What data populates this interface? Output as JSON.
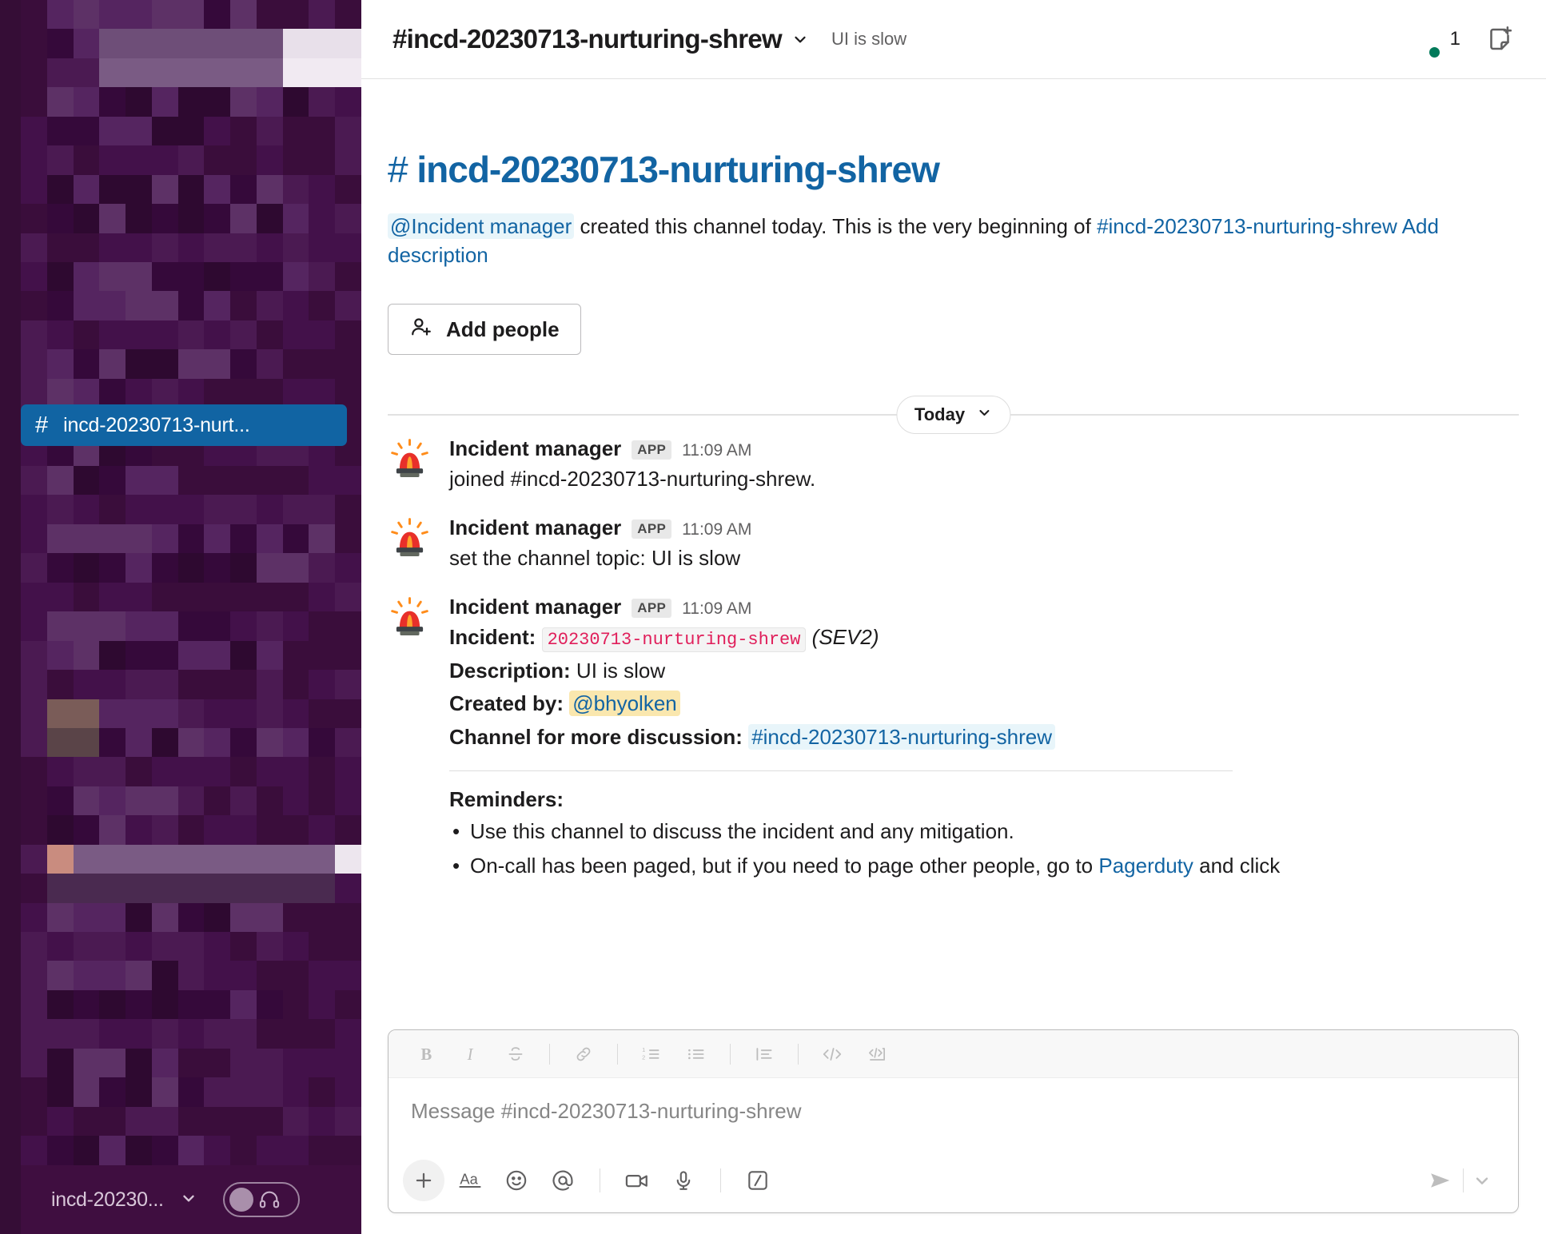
{
  "workspace": {
    "bottom_bar": {
      "name": "incd-20230...",
      "chevron_icon": "chevron-down-icon",
      "huddle_icon": "headphones-icon"
    }
  },
  "sidebar": {
    "selected_channel": {
      "hash": "#",
      "label": "incd-20230713-nurt..."
    }
  },
  "header": {
    "hash": "#",
    "channel_name": "incd-20230713-nurturing-shrew",
    "chevron_icon": "chevron-down-icon",
    "topic": "UI is slow",
    "member_count": "1",
    "avatar_icon": "user-avatar",
    "presence_icon": "online-dot",
    "canvas_icon": "add-canvas-icon"
  },
  "intro": {
    "hash": "#",
    "title": "incd-20230713-nurturing-shrew",
    "creator_mention": "@Incident manager",
    "created_text": " created this channel today. This is the very beginning of ",
    "channel_link": "#incd-20230713-nurturing-shrew",
    "add_description_link": "Add description",
    "add_people_button": "Add people",
    "add_people_icon": "add-person-icon"
  },
  "date_divider": {
    "label": "Today",
    "chevron_icon": "chevron-down-icon"
  },
  "messages": [
    {
      "avatar_icon": "rotating-light-emoji",
      "author": "Incident manager",
      "badge": "APP",
      "time": "11:09 AM",
      "text": "joined #incd-20230713-nurturing-shrew."
    },
    {
      "avatar_icon": "rotating-light-emoji",
      "author": "Incident manager",
      "badge": "APP",
      "time": "11:09 AM",
      "text": "set the channel topic: UI is slow"
    }
  ],
  "incident_message": {
    "avatar_icon": "rotating-light-emoji",
    "author": "Incident manager",
    "badge": "APP",
    "time": "11:09 AM",
    "incident_label": "Incident:",
    "incident_code": "20230713-nurturing-shrew",
    "severity": "(SEV2)",
    "description_label": "Description:",
    "description_value": "UI is slow",
    "created_by_label": "Created by:",
    "created_by_value": "@bhyolken",
    "channel_label": "Channel for more discussion:",
    "channel_value": "#incd-20230713-nurturing-shrew",
    "reminders_title": "Reminders:",
    "reminder_1": "Use this channel to discuss the incident and any mitigation.",
    "reminder_2_part1": "On-call has been paged, but if you need to page other people, go to ",
    "reminder_2_link": "Pagerduty",
    "reminder_2_part2": " and click"
  },
  "composer": {
    "placeholder": "Message #incd-20230713-nurturing-shrew",
    "format_buttons": [
      {
        "name": "bold-icon",
        "label": "B"
      },
      {
        "name": "italic-icon",
        "label": "I"
      },
      {
        "name": "strikethrough-icon",
        "label": "S"
      },
      {
        "name": "link-icon",
        "label": "Link"
      },
      {
        "name": "ordered-list-icon",
        "label": "Ordered list"
      },
      {
        "name": "bulleted-list-icon",
        "label": "Bulleted list"
      },
      {
        "name": "blockquote-icon",
        "label": "Blockquote"
      },
      {
        "name": "code-icon",
        "label": "Code"
      },
      {
        "name": "code-block-icon",
        "label": "Code block"
      }
    ],
    "action_buttons": [
      {
        "name": "plus-icon",
        "label": "Add"
      },
      {
        "name": "text-format-icon",
        "label": "Aa"
      },
      {
        "name": "emoji-icon",
        "label": "Emoji"
      },
      {
        "name": "mention-icon",
        "label": "Mention"
      },
      {
        "name": "video-icon",
        "label": "Video clip"
      },
      {
        "name": "microphone-icon",
        "label": "Audio clip"
      },
      {
        "name": "slash-command-icon",
        "label": "Shortcuts"
      }
    ],
    "send_icon": "send-icon",
    "send_options_icon": "chevron-down-icon"
  },
  "colors": {
    "sidebar_bg": "#3F0E40",
    "selected_channel_bg": "#1164A3",
    "link_blue": "#1264A3",
    "code_pink": "#E01E5A",
    "self_mention_bg": "#FAE7AE",
    "online_green": "#007A5A"
  }
}
